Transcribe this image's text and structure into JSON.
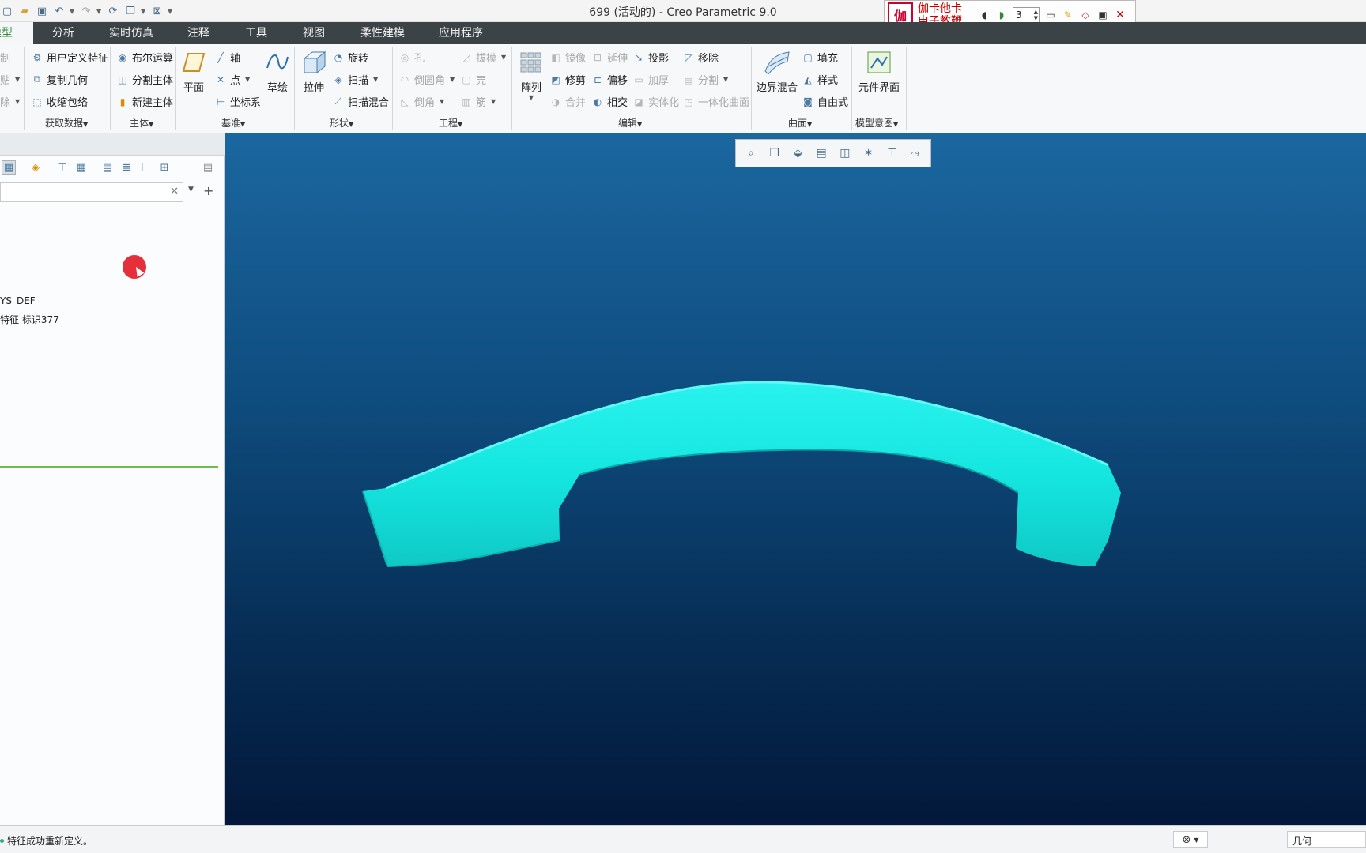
{
  "window": {
    "title": "699 (活动的) - Creo Parametric 9.0"
  },
  "annotation_toolbar": {
    "brand_line1": "伽卡他卡",
    "brand_line2": "电子教鞭",
    "logo": "伽",
    "number": "3"
  },
  "tabs": [
    {
      "label": "模型",
      "display": "模型",
      "active": true
    },
    {
      "label": "分析"
    },
    {
      "label": "实时仿真"
    },
    {
      "label": "注释"
    },
    {
      "label": "工具"
    },
    {
      "label": "视图"
    },
    {
      "label": "柔性建模"
    },
    {
      "label": "应用程序"
    }
  ],
  "ribbon": {
    "get_data": {
      "items": [
        "用户定义特征",
        "复制几何",
        "收缩包络"
      ],
      "group": "获取数据"
    },
    "body": {
      "items": [
        "布尔运算",
        "分割主体",
        "新建主体"
      ],
      "group": "主体"
    },
    "datum": {
      "plane": "平面",
      "axis": "轴",
      "point": "点",
      "csys": "坐标系",
      "sketch": "草绘",
      "group": "基准"
    },
    "shapes": {
      "extrude": "拉伸",
      "revolve": "旋转",
      "sweep": "扫描",
      "swept_blend": "扫描混合",
      "group": "形状"
    },
    "engineering": {
      "hole": "孔",
      "round": "倒圆角",
      "chamfer": "倒角",
      "draft": "拔模",
      "shell": "壳",
      "rib": "筋",
      "group": "工程"
    },
    "editing": {
      "pattern": "阵列",
      "mirror": "镜像",
      "trim": "修剪",
      "merge": "合并",
      "extend": "延伸",
      "offset": "偏移",
      "intersect": "相交",
      "project": "投影",
      "thicken": "加厚",
      "solidify": "实体化",
      "remove": "移除",
      "split": "分割",
      "unify": "一体化曲面",
      "group": "编辑"
    },
    "surfaces": {
      "boundary": "边界混合",
      "fill": "填充",
      "style": "样式",
      "freestyle": "自由式",
      "group": "曲面"
    },
    "intent": {
      "component_interface": "元件界面",
      "group": "模型意图"
    }
  },
  "tree": {
    "item1": "YS_DEF",
    "item2": "特征 标识377"
  },
  "status": {
    "message": "特征成功重新定义。",
    "filter": "几何"
  }
}
